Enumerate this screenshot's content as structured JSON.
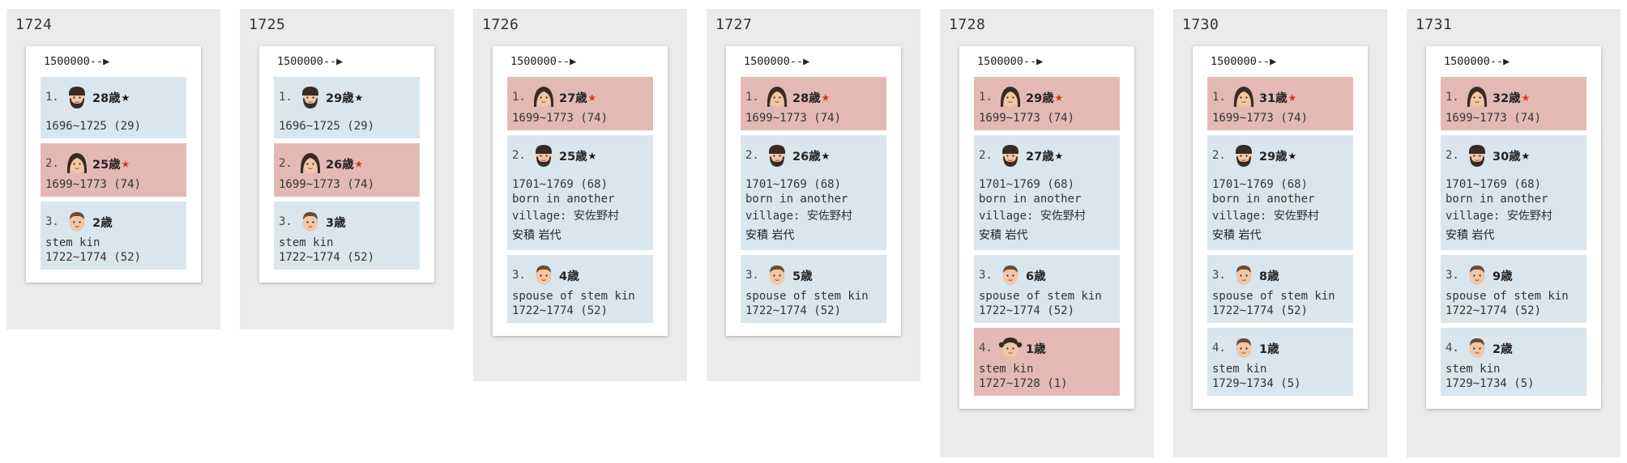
{
  "header_arrow": "1500000--▶",
  "years": [
    {
      "year": "1724",
      "people": [
        {
          "index": "1.",
          "avatar": "man-beard",
          "age": "28歳",
          "star": "black",
          "lines": [
            "",
            "1696~1725 (29)"
          ],
          "gender": "male"
        },
        {
          "index": "2.",
          "avatar": "woman",
          "age": "25歳",
          "star": "red",
          "lines": [
            "1699~1773 (74)"
          ],
          "gender": "female"
        },
        {
          "index": "3.",
          "avatar": "child",
          "age": "2歳",
          "star": "",
          "lines": [
            "stem kin",
            "1722~1774 (52)"
          ],
          "gender": "male"
        }
      ]
    },
    {
      "year": "1725",
      "people": [
        {
          "index": "1.",
          "avatar": "man-beard",
          "age": "29歳",
          "star": "black",
          "lines": [
            "",
            "1696~1725 (29)"
          ],
          "gender": "male"
        },
        {
          "index": "2.",
          "avatar": "woman",
          "age": "26歳",
          "star": "red",
          "lines": [
            "1699~1773 (74)"
          ],
          "gender": "female"
        },
        {
          "index": "3.",
          "avatar": "child",
          "age": "3歳",
          "star": "",
          "lines": [
            "stem kin",
            "1722~1774 (52)"
          ],
          "gender": "male"
        }
      ]
    },
    {
      "year": "1726",
      "people": [
        {
          "index": "1.",
          "avatar": "woman",
          "age": "27歳",
          "star": "red",
          "lines": [
            "1699~1773 (74)"
          ],
          "gender": "female"
        },
        {
          "index": "2.",
          "avatar": "man-beard",
          "age": "25歳",
          "star": "black",
          "lines": [
            "",
            "1701~1769 (68)",
            "born in another",
            "village: 安佐野村",
            "安積 岩代"
          ],
          "gender": "male"
        },
        {
          "index": "3.",
          "avatar": "child",
          "age": "4歳",
          "star": "",
          "lines": [
            "spouse of stem kin",
            "1722~1774 (52)"
          ],
          "gender": "male"
        }
      ]
    },
    {
      "year": "1727",
      "people": [
        {
          "index": "1.",
          "avatar": "woman",
          "age": "28歳",
          "star": "red",
          "lines": [
            "1699~1773 (74)"
          ],
          "gender": "female"
        },
        {
          "index": "2.",
          "avatar": "man-beard",
          "age": "26歳",
          "star": "black",
          "lines": [
            "",
            "1701~1769 (68)",
            "born in another",
            "village: 安佐野村",
            "安積 岩代"
          ],
          "gender": "male"
        },
        {
          "index": "3.",
          "avatar": "child",
          "age": "5歳",
          "star": "",
          "lines": [
            "spouse of stem kin",
            "1722~1774 (52)"
          ],
          "gender": "male"
        }
      ]
    },
    {
      "year": "1728",
      "people": [
        {
          "index": "1.",
          "avatar": "woman",
          "age": "29歳",
          "star": "red",
          "lines": [
            "1699~1773 (74)"
          ],
          "gender": "female"
        },
        {
          "index": "2.",
          "avatar": "man-beard",
          "age": "27歳",
          "star": "black",
          "lines": [
            "",
            "1701~1769 (68)",
            "born in another",
            "village: 安佐野村",
            "安積 岩代"
          ],
          "gender": "male"
        },
        {
          "index": "3.",
          "avatar": "child",
          "age": "6歳",
          "star": "",
          "lines": [
            "spouse of stem kin",
            "1722~1774 (52)"
          ],
          "gender": "male"
        },
        {
          "index": "4.",
          "avatar": "girl",
          "age": "1歳",
          "star": "",
          "lines": [
            "stem kin",
            "1727~1728 (1)"
          ],
          "gender": "female"
        }
      ]
    },
    {
      "year": "1730",
      "people": [
        {
          "index": "1.",
          "avatar": "woman",
          "age": "31歳",
          "star": "red",
          "lines": [
            "1699~1773 (74)"
          ],
          "gender": "female"
        },
        {
          "index": "2.",
          "avatar": "man-beard",
          "age": "29歳",
          "star": "black",
          "lines": [
            "",
            "1701~1769 (68)",
            "born in another",
            "village: 安佐野村",
            "安積 岩代"
          ],
          "gender": "male"
        },
        {
          "index": "3.",
          "avatar": "child",
          "age": "8歳",
          "star": "",
          "lines": [
            "spouse of stem kin",
            "1722~1774 (52)"
          ],
          "gender": "male"
        },
        {
          "index": "4.",
          "avatar": "child",
          "age": "1歳",
          "star": "",
          "lines": [
            "stem kin",
            "1729~1734 (5)"
          ],
          "gender": "male"
        }
      ]
    },
    {
      "year": "1731",
      "people": [
        {
          "index": "1.",
          "avatar": "woman",
          "age": "32歳",
          "star": "red",
          "lines": [
            "1699~1773 (74)"
          ],
          "gender": "female"
        },
        {
          "index": "2.",
          "avatar": "man-beard",
          "age": "30歳",
          "star": "black",
          "lines": [
            "",
            "1701~1769 (68)",
            "born in another",
            "village: 安佐野村",
            "安積 岩代"
          ],
          "gender": "male"
        },
        {
          "index": "3.",
          "avatar": "child",
          "age": "9歳",
          "star": "",
          "lines": [
            "spouse of stem kin",
            "1722~1774 (52)"
          ],
          "gender": "male"
        },
        {
          "index": "4.",
          "avatar": "child",
          "age": "2歳",
          "star": "",
          "lines": [
            "stem kin",
            "1729~1734 (5)"
          ],
          "gender": "male"
        }
      ]
    }
  ],
  "colors": {
    "male_bg": "#d9e6ee",
    "female_bg": "#e4b9b4",
    "panel_bg": "#ebebeb",
    "star_red": "#cc3a1e"
  }
}
